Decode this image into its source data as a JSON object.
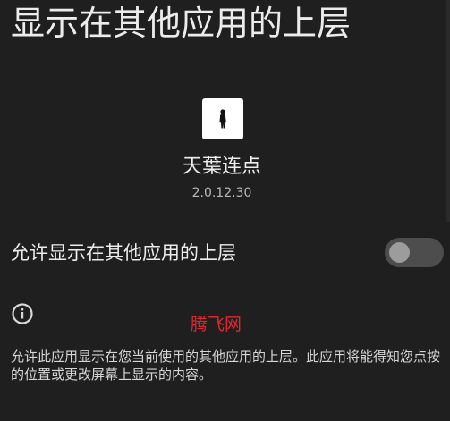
{
  "header": {
    "title": "显示在其他应用的上层"
  },
  "app": {
    "name": "天葉连点",
    "version": "2.0.12.30",
    "icon": "app-icon-figure"
  },
  "setting": {
    "label": "允许显示在其他应用的上层",
    "enabled": false
  },
  "info": {
    "icon": "info-icon",
    "description": "允许此应用显示在您当前使用的其他应用的上层。此应用将能得知您点按的位置或更改屏幕上显示的内容。"
  },
  "watermark": {
    "text": "腾飞网"
  },
  "colors": {
    "background": "#1f1f1f",
    "text": "#ececec",
    "watermark": "#e0282e",
    "switch_track_off": "#4d4d4d",
    "switch_thumb_off": "#9c9c9c"
  }
}
